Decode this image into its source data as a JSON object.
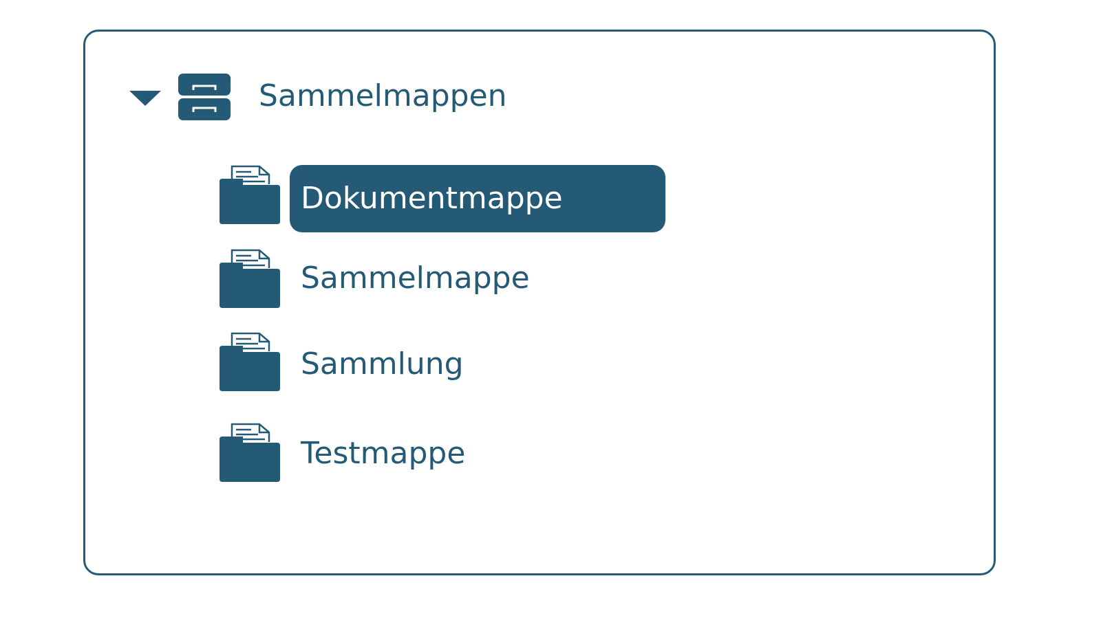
{
  "tree": {
    "root": {
      "label": "Sammelmappen",
      "expanded": true,
      "icon": "file-cabinet-icon",
      "toggle_icon": "caret-down-icon"
    },
    "children": [
      {
        "label": "Dokumentmappe",
        "icon": "folder-with-document-icon",
        "selected": true
      },
      {
        "label": "Sammelmappe",
        "icon": "folder-with-document-icon",
        "selected": false
      },
      {
        "label": "Sammlung",
        "icon": "folder-with-document-icon",
        "selected": false
      },
      {
        "label": "Testmappe",
        "icon": "folder-with-document-icon",
        "selected": false
      }
    ]
  },
  "colors": {
    "accent": "#245a75",
    "selected_text": "#ffffff",
    "background": "#ffffff"
  }
}
